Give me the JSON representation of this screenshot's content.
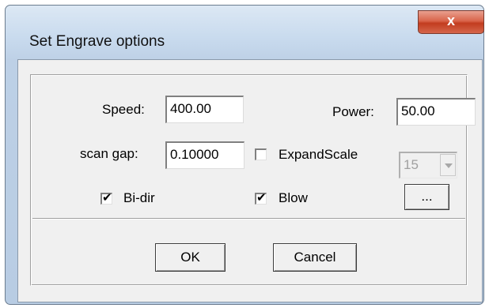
{
  "window": {
    "title": "Set Engrave options",
    "close_glyph": "x"
  },
  "fields": {
    "speed_label": "Speed:",
    "speed_value": "400.00",
    "power_label": "Power:",
    "power_value": "50.00",
    "scan_gap_label": "scan gap:",
    "scan_gap_value": "0.10000",
    "expand_scale_label": "ExpandScale",
    "expand_scale_checked": false,
    "expand_scale_value": "15",
    "bidir_label": "Bi-dir",
    "bidir_checked": true,
    "blow_label": "Blow",
    "blow_checked": true,
    "browse_label": "..."
  },
  "buttons": {
    "ok_label": "OK",
    "cancel_label": "Cancel"
  }
}
